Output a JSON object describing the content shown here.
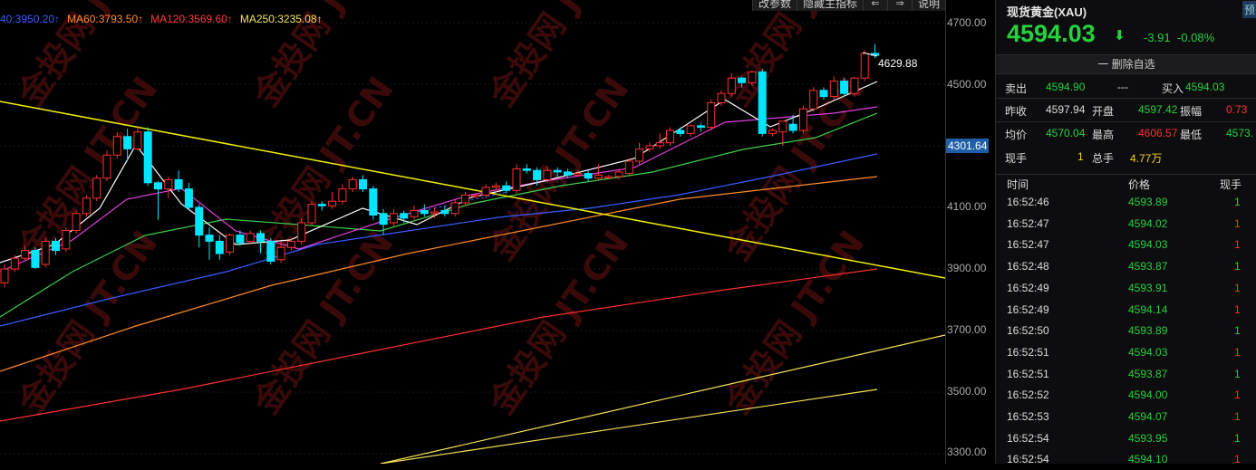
{
  "chart": {
    "ma_legend": [
      {
        "label": "40:3950.20↑",
        "color": "#3a5cff"
      },
      {
        "label": "MA60:3793.50↑",
        "color": "#ff8c2a"
      },
      {
        "label": "MA120:3569.60↑",
        "color": "#ff3b3b"
      },
      {
        "label": "MA250:3235.08↑",
        "color": "#f5e55a"
      }
    ],
    "toolbar": [
      "改参数",
      "隐藏主指标",
      "⇐",
      "⇒",
      "说明"
    ],
    "high_marker": "4629.88",
    "price_ticks": [
      "4700.00",
      "4500.00",
      "4100.00",
      "3900.00",
      "3700.00",
      "3500.00",
      "3300.00"
    ],
    "current_price_tag": "4301.64",
    "watermark": "金投网 JT.CN",
    "colors": {
      "up": "#ff3030",
      "down": "#00e5ff",
      "bg": "#000000",
      "trend": "#f5f000"
    }
  },
  "chart_data": {
    "type": "candlestick",
    "y_unit": "price",
    "visible_range": [
      3300,
      4740
    ],
    "candles": [
      [
        3855,
        3900,
        3840,
        3915
      ],
      [
        3900,
        3935,
        3890,
        3945
      ],
      [
        3935,
        3960,
        3925,
        3975
      ],
      [
        3960,
        3905,
        3900,
        3970
      ],
      [
        3915,
        3990,
        3905,
        4000
      ],
      [
        3990,
        3960,
        3945,
        4000
      ],
      [
        3965,
        4025,
        3955,
        4035
      ],
      [
        4025,
        4080,
        4015,
        4090
      ],
      [
        4080,
        4130,
        4070,
        4140
      ],
      [
        4130,
        4195,
        4120,
        4205
      ],
      [
        4195,
        4270,
        4185,
        4285
      ],
      [
        4270,
        4330,
        4260,
        4345
      ],
      [
        4330,
        4290,
        4250,
        4355
      ],
      [
        4290,
        4345,
        4285,
        4360
      ],
      [
        4345,
        4180,
        4170,
        4360
      ],
      [
        4180,
        4160,
        4060,
        4185
      ],
      [
        4160,
        4190,
        4130,
        4200
      ],
      [
        4190,
        4160,
        4150,
        4220
      ],
      [
        4160,
        4100,
        4090,
        4180
      ],
      [
        4100,
        4010,
        3970,
        4110
      ],
      [
        4010,
        3990,
        3930,
        4035
      ],
      [
        3990,
        3950,
        3930,
        4010
      ],
      [
        3955,
        4010,
        3945,
        4015
      ],
      [
        4010,
        3985,
        3975,
        4025
      ],
      [
        3990,
        4015,
        3980,
        4025
      ],
      [
        4015,
        3990,
        3950,
        4025
      ],
      [
        3990,
        3925,
        3915,
        4000
      ],
      [
        3930,
        3970,
        3920,
        3990
      ],
      [
        3970,
        3990,
        3960,
        4000
      ],
      [
        3990,
        4050,
        3980,
        4065
      ],
      [
        4050,
        4110,
        4040,
        4120
      ],
      [
        4110,
        4105,
        4090,
        4120
      ],
      [
        4105,
        4120,
        4095,
        4150
      ],
      [
        4120,
        4160,
        4110,
        4175
      ],
      [
        4160,
        4190,
        4150,
        4200
      ],
      [
        4190,
        4160,
        4150,
        4205
      ],
      [
        4160,
        4075,
        4060,
        4170
      ],
      [
        4080,
        4045,
        4010,
        4095
      ],
      [
        4050,
        4080,
        4040,
        4095
      ],
      [
        4080,
        4065,
        4050,
        4090
      ],
      [
        4070,
        4090,
        4060,
        4105
      ],
      [
        4090,
        4080,
        4070,
        4110
      ],
      [
        4080,
        4085,
        4065,
        4100
      ],
      [
        4090,
        4080,
        4070,
        4105
      ],
      [
        4080,
        4115,
        4070,
        4125
      ],
      [
        4115,
        4140,
        4105,
        4150
      ],
      [
        4140,
        4140,
        4130,
        4145
      ],
      [
        4140,
        4165,
        4130,
        4175
      ],
      [
        4165,
        4170,
        4150,
        4180
      ],
      [
        4170,
        4155,
        4145,
        4185
      ],
      [
        4155,
        4225,
        4145,
        4240
      ],
      [
        4225,
        4220,
        4210,
        4240
      ],
      [
        4220,
        4190,
        4170,
        4230
      ],
      [
        4190,
        4220,
        4180,
        4235
      ],
      [
        4220,
        4215,
        4200,
        4230
      ],
      [
        4215,
        4205,
        4195,
        4225
      ],
      [
        4205,
        4210,
        4200,
        4220
      ],
      [
        4210,
        4195,
        4185,
        4220
      ],
      [
        4195,
        4205,
        4190,
        4240
      ],
      [
        4200,
        4200,
        4195,
        4205
      ],
      [
        4200,
        4215,
        4190,
        4225
      ],
      [
        4210,
        4250,
        4200,
        4260
      ],
      [
        4250,
        4290,
        4240,
        4310
      ],
      [
        4290,
        4300,
        4280,
        4310
      ],
      [
        4300,
        4310,
        4290,
        4340
      ],
      [
        4310,
        4350,
        4300,
        4360
      ],
      [
        4350,
        4340,
        4330,
        4360
      ],
      [
        4340,
        4365,
        4330,
        4370
      ],
      [
        4365,
        4360,
        4345,
        4375
      ],
      [
        4360,
        4440,
        4350,
        4450
      ],
      [
        4440,
        4470,
        4430,
        4480
      ],
      [
        4470,
        4520,
        4460,
        4535
      ],
      [
        4520,
        4505,
        4490,
        4525
      ],
      [
        4505,
        4540,
        4495,
        4545
      ],
      [
        4540,
        4340,
        4330,
        4550
      ],
      [
        4340,
        4350,
        4330,
        4355
      ],
      [
        4345,
        4380,
        4300,
        4380
      ],
      [
        4370,
        4350,
        4340,
        4400
      ],
      [
        4350,
        4420,
        4340,
        4430
      ],
      [
        4420,
        4480,
        4410,
        4490
      ],
      [
        4480,
        4460,
        4450,
        4490
      ],
      [
        4460,
        4510,
        4450,
        4525
      ],
      [
        4510,
        4470,
        4460,
        4520
      ],
      [
        4470,
        4520,
        4460,
        4525
      ],
      [
        4520,
        4600,
        4510,
        4610
      ],
      [
        4600,
        4594,
        4585,
        4630
      ]
    ]
  },
  "sidebar": {
    "title": "现货黄金(XAU)",
    "badge": "预",
    "price": "4594.03",
    "arrow": "⬇",
    "change": "-3.91",
    "change_pct": "-0.08%",
    "delete_button": "一 删除自选",
    "quote_rows": [
      [
        {
          "label": "卖出",
          "value": "4594.90",
          "color": "#27d13e"
        },
        {
          "label": "---",
          "value": "",
          "color": "#ddd"
        },
        {
          "label": "买入",
          "value": "4594.03",
          "color": "#27d13e"
        }
      ],
      [
        {
          "label": "昨收",
          "value": "4597.94",
          "color": "#ddd"
        },
        {
          "label": "开盘",
          "value": "4597.42",
          "color": "#27d13e"
        },
        {
          "label": "振幅",
          "value": "0.73",
          "color": "#ff3030"
        }
      ],
      [
        {
          "label": "均价",
          "value": "4570.04",
          "color": "#27d13e"
        },
        {
          "label": "最高",
          "value": "4606.57",
          "color": "#ff3030"
        },
        {
          "label": "最低",
          "value": "4573.",
          "color": "#27d13e"
        }
      ],
      [
        {
          "label": "现手",
          "value": "1",
          "color": "#f5d020"
        },
        {
          "label": "总手",
          "value": "4.77万",
          "color": "#f5d020"
        },
        {
          "label": "",
          "value": "",
          "color": "#ddd"
        }
      ]
    ],
    "trade_headers": [
      "时间",
      "价格",
      "现手"
    ],
    "trades": [
      {
        "time": "16:52:46",
        "price": "4593.89",
        "vol": "1",
        "vcolor": "#27d13e"
      },
      {
        "time": "16:52:47",
        "price": "4594.02",
        "vol": "1",
        "vcolor": "#ff3030"
      },
      {
        "time": "16:52:47",
        "price": "4594.03",
        "vol": "1",
        "vcolor": "#ff3030"
      },
      {
        "time": "16:52:48",
        "price": "4593.87",
        "vol": "1",
        "vcolor": "#27d13e"
      },
      {
        "time": "16:52:49",
        "price": "4593.91",
        "vol": "1",
        "vcolor": "#ff3030"
      },
      {
        "time": "16:52:49",
        "price": "4594.14",
        "vol": "1",
        "vcolor": "#ff3030"
      },
      {
        "time": "16:52:50",
        "price": "4593.89",
        "vol": "1",
        "vcolor": "#27d13e"
      },
      {
        "time": "16:52:51",
        "price": "4594.03",
        "vol": "1",
        "vcolor": "#ff3030"
      },
      {
        "time": "16:52:51",
        "price": "4593.87",
        "vol": "1",
        "vcolor": "#27d13e"
      },
      {
        "time": "16:52:52",
        "price": "4594.00",
        "vol": "1",
        "vcolor": "#ff3030"
      },
      {
        "time": "16:52:53",
        "price": "4594.07",
        "vol": "1",
        "vcolor": "#ff3030"
      },
      {
        "time": "16:52:54",
        "price": "4593.95",
        "vol": "1",
        "vcolor": "#27d13e"
      },
      {
        "time": "16:52:54",
        "price": "4594.10",
        "vol": "1",
        "vcolor": "#ff3030"
      }
    ]
  }
}
